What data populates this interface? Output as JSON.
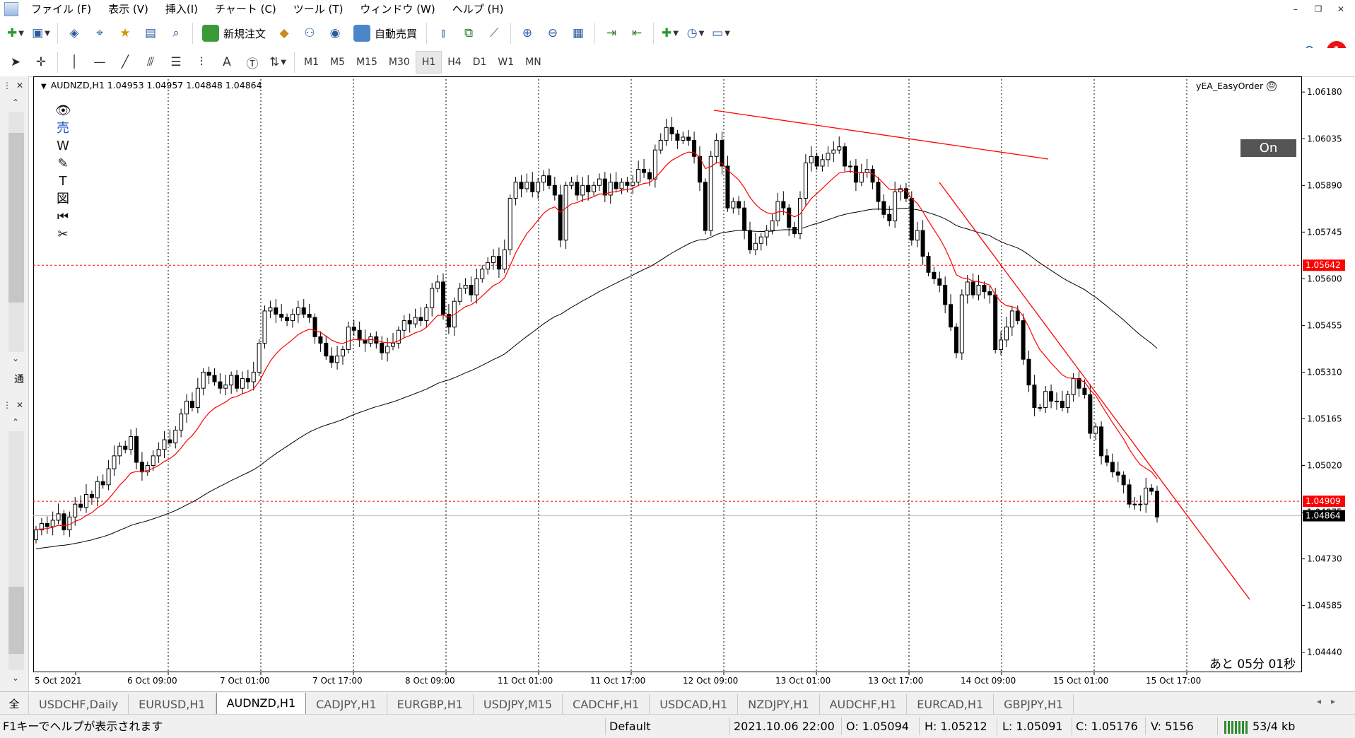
{
  "menu": [
    "ファイル (F)",
    "表示 (V)",
    "挿入(I)",
    "チャート (C)",
    "ツール (T)",
    "ウィンドウ (W)",
    "ヘルプ (H)"
  ],
  "toolbar": {
    "new_order": "新規注文",
    "auto_trade": "自動売買",
    "notification_count": "1"
  },
  "timeframes": [
    "M1",
    "M5",
    "M15",
    "M30",
    "H1",
    "H4",
    "D1",
    "W1",
    "MN"
  ],
  "active_timeframe": "H1",
  "left_panel": {
    "top_label": "通",
    "bottom_label": "全"
  },
  "chart": {
    "header": "AUDNZD,H1  1.04953 1.04957 1.04848 1.04864",
    "ea_name": "yEA_EasyOrder",
    "on_button": "On",
    "countdown": "あと 05分 01秒",
    "tool_icons": [
      "eye-icon",
      "sell-icon",
      "w-icon",
      "pencil-icon",
      "text-icon",
      "picture-icon",
      "rewind-icon",
      "scissors-icon"
    ],
    "tool_labels": [
      "👁",
      "売",
      "W",
      "✎",
      "T",
      "図",
      "⏮",
      "✂"
    ]
  },
  "chart_data": {
    "type": "candlestick",
    "symbol": "AUDNZD",
    "timeframe": "H1",
    "price_ticks": [
      "1.06180",
      "1.06035",
      "1.05890",
      "1.05745",
      "1.05600",
      "1.05455",
      "1.05310",
      "1.05165",
      "1.05020",
      "1.04875",
      "1.04730",
      "1.04585",
      "1.04440"
    ],
    "ylim": [
      1.0438,
      1.0622
    ],
    "time_labels": [
      "5 Oct 2021",
      "6 Oct 09:00",
      "7 Oct 01:00",
      "7 Oct 17:00",
      "8 Oct 09:00",
      "11 Oct 01:00",
      "11 Oct 17:00",
      "12 Oct 09:00",
      "13 Oct 01:00",
      "13 Oct 17:00",
      "14 Oct 09:00",
      "15 Oct 01:00",
      "15 Oct 17:00"
    ],
    "price_labels": [
      {
        "value": "1.05642",
        "color": "#ff0000"
      },
      {
        "value": "1.04909",
        "color": "#ff0000"
      },
      {
        "value": "1.04864",
        "color": "#000000"
      }
    ],
    "horizontal_lines": [
      1.05642,
      1.04909
    ],
    "bid_line": 1.04864,
    "close_series": [
      1.0482,
      1.0484,
      1.0483,
      1.0485,
      1.0487,
      1.0482,
      1.0486,
      1.049,
      1.0489,
      1.0493,
      1.0492,
      1.0497,
      1.0496,
      1.0501,
      1.0505,
      1.0508,
      1.0507,
      1.0511,
      1.0503,
      1.05,
      1.0502,
      1.0505,
      1.0507,
      1.051,
      1.0509,
      1.0513,
      1.0518,
      1.0522,
      1.052,
      1.0526,
      1.0531,
      1.053,
      1.0528,
      1.0526,
      1.0527,
      1.053,
      1.0526,
      1.0529,
      1.0528,
      1.0531,
      1.054,
      1.055,
      1.0551,
      1.0549,
      1.0548,
      1.0547,
      1.0549,
      1.0551,
      1.0549,
      1.0548,
      1.0542,
      1.054,
      1.0536,
      1.0534,
      1.0536,
      1.0538,
      1.0545,
      1.0544,
      1.0541,
      1.054,
      1.0542,
      1.054,
      1.0537,
      1.0539,
      1.054,
      1.0544,
      1.0547,
      1.0546,
      1.0548,
      1.0547,
      1.0551,
      1.0557,
      1.0559,
      1.0549,
      1.0545,
      1.0553,
      1.0557,
      1.0558,
      1.0555,
      1.056,
      1.0563,
      1.0565,
      1.0567,
      1.0563,
      1.0569,
      1.0585,
      1.059,
      1.0588,
      1.059,
      1.0587,
      1.059,
      1.0592,
      1.0589,
      1.0586,
      1.0572,
      1.0589,
      1.059,
      1.0586,
      1.0589,
      1.0587,
      1.0589,
      1.0591,
      1.0586,
      1.059,
      1.0588,
      1.059,
      1.0589,
      1.059,
      1.0594,
      1.0593,
      1.0591,
      1.06,
      1.0603,
      1.0607,
      1.0605,
      1.0603,
      1.0604,
      1.0603,
      1.0598,
      1.059,
      1.0575,
      1.0598,
      1.0603,
      1.0595,
      1.0582,
      1.0584,
      1.0582,
      1.0575,
      1.0569,
      1.0571,
      1.0573,
      1.0575,
      1.0578,
      1.0584,
      1.0582,
      1.0576,
      1.0574,
      1.0585,
      1.0596,
      1.0598,
      1.0595,
      1.0597,
      1.0599,
      1.06,
      1.0601,
      1.0595,
      1.0595,
      1.059,
      1.0593,
      1.0594,
      1.059,
      1.0584,
      1.058,
      1.0578,
      1.0587,
      1.0588,
      1.0585,
      1.0572,
      1.0575,
      1.0567,
      1.0562,
      1.056,
      1.0558,
      1.0552,
      1.0545,
      1.0537,
      1.0555,
      1.0559,
      1.0555,
      1.0558,
      1.0556,
      1.0555,
      1.0538,
      1.0541,
      1.0545,
      1.055,
      1.0547,
      1.0535,
      1.0527,
      1.052,
      1.052,
      1.0525,
      1.0522,
      1.0522,
      1.052,
      1.0524,
      1.0529,
      1.0526,
      1.0524,
      1.0512,
      1.0514,
      1.0505,
      1.0503,
      1.05,
      1.0499,
      1.0496,
      1.049,
      1.049,
      1.049,
      1.0495,
      1.0494,
      1.0486
    ],
    "ma_fast_color": "#ff0000",
    "ma_slow_color": "#000000"
  },
  "tabs": [
    "USDCHF,Daily",
    "EURUSD,H1",
    "AUDNZD,H1",
    "CADJPY,H1",
    "EURGBP,H1",
    "USDJPY,M15",
    "CADCHF,H1",
    "USDCAD,H1",
    "NZDJPY,H1",
    "AUDCHF,H1",
    "EURCAD,H1",
    "GBPJPY,H1"
  ],
  "active_tab": "AUDNZD,H1",
  "status": {
    "help": "F1キーでヘルプが表示されます",
    "profile": "Default",
    "datetime": "2021.10.06 22:00",
    "open": "O: 1.05094",
    "high": "H: 1.05212",
    "low": "L: 1.05091",
    "close": "C: 1.05176",
    "volume": "V: 5156",
    "traffic": "53/4 kb"
  }
}
